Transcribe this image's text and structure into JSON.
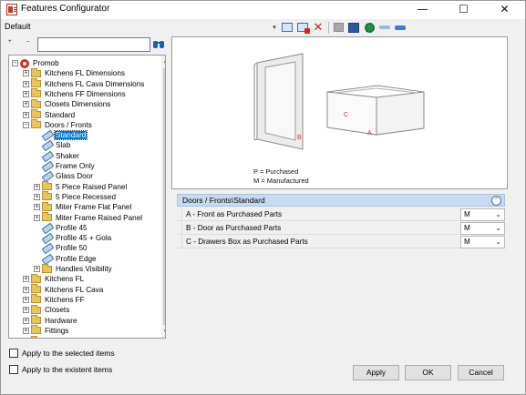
{
  "window": {
    "title": "Features Configurator",
    "minimize": "—",
    "maximize": "☐",
    "close": "✕"
  },
  "profile_label": "Default",
  "toolbar": {
    "icons": [
      "dropdown-arrow",
      "new-item-icon",
      "new-item-red-icon",
      "delete-icon",
      "save-icon",
      "import-icon",
      "settings-icon",
      "key-icon",
      "key-blue-icon"
    ],
    "dropdown_glyph": "▾",
    "delete_glyph": "✕"
  },
  "tree_tools": {
    "expand_all": "+",
    "collapse_all": "−"
  },
  "search": {
    "value": "",
    "placeholder": ""
  },
  "tree": {
    "items": [
      {
        "label": "Promob",
        "level": 0,
        "type": "root",
        "exp": "−"
      },
      {
        "label": "Kitchens FL Dimensions",
        "level": 1,
        "type": "folder",
        "exp": "+"
      },
      {
        "label": "Kitchens FL Cava Dimensions",
        "level": 1,
        "type": "folder",
        "exp": "+"
      },
      {
        "label": "Kitchens FF Dimensions",
        "level": 1,
        "type": "folder",
        "exp": "+"
      },
      {
        "label": "Closets Dimensions",
        "level": 1,
        "type": "folder",
        "exp": "+"
      },
      {
        "label": "Standard",
        "level": 1,
        "type": "folder",
        "exp": "+"
      },
      {
        "label": "Doors / Fronts",
        "level": 1,
        "type": "folder",
        "exp": "−"
      },
      {
        "label": "Standard",
        "level": 2,
        "type": "item",
        "selected": true
      },
      {
        "label": "Slab",
        "level": 2,
        "type": "item"
      },
      {
        "label": "Shaker",
        "level": 2,
        "type": "item"
      },
      {
        "label": "Frame Only",
        "level": 2,
        "type": "item"
      },
      {
        "label": "Glass Door",
        "level": 2,
        "type": "item"
      },
      {
        "label": "5 Piece Raised Panel",
        "level": 2,
        "type": "folder",
        "exp": "+"
      },
      {
        "label": "5 Piece Recessed",
        "level": 2,
        "type": "folder",
        "exp": "+"
      },
      {
        "label": "Miter Frame Flat Panel",
        "level": 2,
        "type": "folder",
        "exp": "+"
      },
      {
        "label": "Miter Frame Raised Panel",
        "level": 2,
        "type": "folder",
        "exp": "+"
      },
      {
        "label": "Profile 45",
        "level": 2,
        "type": "item"
      },
      {
        "label": "Profile 45 + Gola",
        "level": 2,
        "type": "item"
      },
      {
        "label": "Profile 50",
        "level": 2,
        "type": "item"
      },
      {
        "label": "Profile Edge",
        "level": 2,
        "type": "item"
      },
      {
        "label": "Handles Visibility",
        "level": 2,
        "type": "folder",
        "exp": "+"
      },
      {
        "label": "Kitchens FL",
        "level": 1,
        "type": "folder",
        "exp": "+"
      },
      {
        "label": "Kitchens FL Cava",
        "level": 1,
        "type": "folder",
        "exp": "+"
      },
      {
        "label": "Kitchens FF",
        "level": 1,
        "type": "folder",
        "exp": "+"
      },
      {
        "label": "Closets",
        "level": 1,
        "type": "folder",
        "exp": "+"
      },
      {
        "label": "Hardware",
        "level": 1,
        "type": "folder",
        "exp": "+"
      },
      {
        "label": "Fittings",
        "level": 1,
        "type": "folder",
        "exp": "+"
      },
      {
        "label": "Pl...",
        "level": 1,
        "type": "folder",
        "exp": "+"
      }
    ]
  },
  "scroll": {
    "up": "▲",
    "down": "▼"
  },
  "checkboxes": {
    "selected_items": {
      "label": "Apply to the selected items",
      "checked": false
    },
    "existent_items": {
      "label": "Apply to the existent items",
      "checked": false
    }
  },
  "preview": {
    "labels": {
      "b": "B",
      "c": "C",
      "a": "A"
    },
    "legend_line1": "P = Purchased",
    "legend_line2": "M = Manufactured"
  },
  "section": {
    "title": "Doors / Fronts\\Standard",
    "collapse_glyph": "⌃"
  },
  "properties": [
    {
      "name": "A - Front as Purchased Parts",
      "value": "M"
    },
    {
      "name": "B - Door as Purchased Parts",
      "value": "M"
    },
    {
      "name": "C - Drawers Box as Purchased Parts",
      "value": "M"
    }
  ],
  "dropdown_chevron": "⌄",
  "buttons": {
    "apply": "Apply",
    "ok": "OK",
    "cancel": "Cancel"
  },
  "colors": {
    "selection": "#0078d7",
    "section_header": "#c7daf1",
    "annotation": "#d42a2a"
  }
}
